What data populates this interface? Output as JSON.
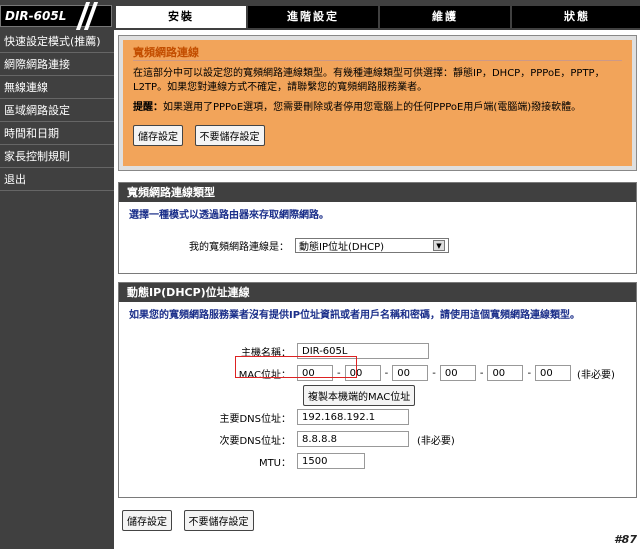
{
  "logo": "DIR-605L",
  "tabs": [
    "安裝",
    "進階設定",
    "維護",
    "狀態"
  ],
  "sidebar": [
    "快速設定模式(推薦)",
    "網際網路連接",
    "無線連線",
    "區域網路設定",
    "時間和日期",
    "家長控制規則",
    "退出"
  ],
  "intro": {
    "title": "寬頻網路連線",
    "text": "在這部分中可以設定您的寬頻網路連線類型。有幾種連線類型可供選擇：靜態IP，DHCP，PPPoE，PPTP，L2TP。如果您對連線方式不確定，請聯繫您的寬頻網路服務業者。",
    "warn_label": "提醒：",
    "warn_text": "如果選用了PPPoE選項，您需要刪除或者停用您電腦上的任何PPPoE用戶端(電腦端)撥接軟體。",
    "save": "儲存設定",
    "nosave": "不要儲存設定"
  },
  "type_section": {
    "title": "寬頻網路連線類型",
    "desc": "選擇一種模式以透過路由器來存取網際網路。",
    "label": "我的寬頻網路連線是：",
    "value": "動態IP位址(DHCP)"
  },
  "dhcp_section": {
    "title": "動態IP(DHCP)位址連線",
    "desc": "如果您的寬頻網路服務業者沒有提供IP位址資訊或者用戶名稱和密碼，請使用這個寬頻網路連線類型。",
    "host_label": "主機名稱：",
    "host_value": "DIR-605L",
    "mac_label": "MAC位址：",
    "mac": [
      "00",
      "00",
      "00",
      "00",
      "00",
      "00"
    ],
    "mac_note": "(非必要)",
    "clone": "複製本機端的MAC位址",
    "dns1_label": "主要DNS位址：",
    "dns1_value": "192.168.192.1",
    "dns2_label": "次要DNS位址：",
    "dns2_value": "8.8.8.8",
    "dns2_note": "(非必要)",
    "mtu_label": "MTU：",
    "mtu_value": "1500"
  },
  "bottom": {
    "save": "儲存設定",
    "nosave": "不要儲存設定"
  },
  "badge": "#87"
}
